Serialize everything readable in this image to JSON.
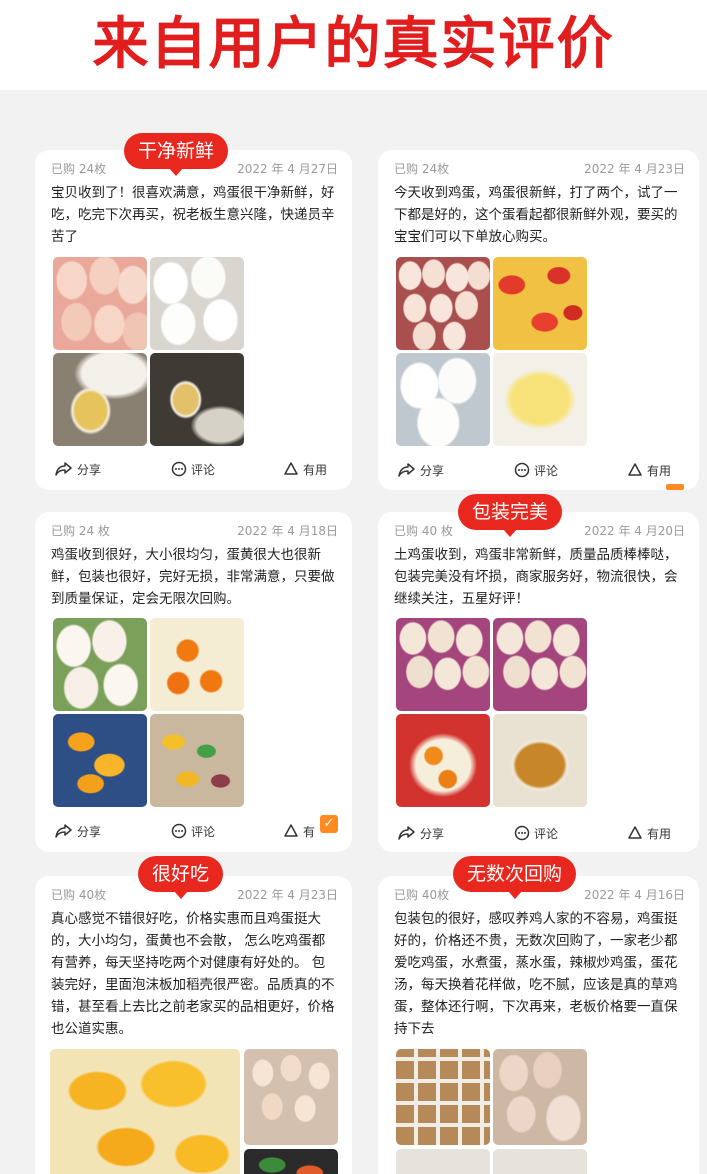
{
  "headline": "来自用户的真实评价",
  "colors": {
    "accent_red": "#e8281f",
    "headline_red": "#e11d1d",
    "check_orange": "#ff8a1f"
  },
  "actions": {
    "share": "分享",
    "comment": "评论",
    "useful": "有用"
  },
  "icons": {
    "share": "share-icon",
    "comment": "comment-icon",
    "useful": "thumb-up-icon"
  },
  "reviews": [
    {
      "tag": "干净新鲜",
      "quantity": "已购 24枚",
      "date": "2022 年 4 月27日",
      "text": "宝贝收到了！很喜欢满意，鸡蛋很干净新鲜，好吃，吃完下次再买，祝老板生意兴隆，快递员辛苦了",
      "useful_label": "有用"
    },
    {
      "tag": "",
      "quantity": "已购 24枚",
      "date": "2022 年 4 月23日",
      "text": "今天收到鸡蛋，鸡蛋很新鲜，打了两个，试了一下都是好的，这个蛋看起都很新鲜外观，要买的宝宝们可以下单放心购买。",
      "useful_label": "有用"
    },
    {
      "tag": "",
      "quantity": "已购 24 枚",
      "date": "2022 年 4 月18日",
      "text": "鸡蛋收到很好，大小很均匀，蛋黄很大也很新鲜，包装也很好，完好无损，非常满意，只要做到质量保证，定会无限次回购。",
      "useful_label": "有"
    },
    {
      "tag": "包装完美",
      "quantity": "已购 40 枚",
      "date": "2022 年 4 月20日",
      "text": "土鸡蛋收到，鸡蛋非常新鲜，质量品质棒棒哒，包装完美没有坏损，商家服务好，物流很快，会继续关注，五星好评！",
      "useful_label": "有用"
    },
    {
      "tag": "很好吃",
      "quantity": "已购 40枚",
      "date": "2022 年 4 月23日",
      "text": "真心感觉不错很好吃，价格实惠而且鸡蛋挺大的，大小均匀，蛋黄也不会散， 怎么吃鸡蛋都有营养，每天坚持吃两个对健康有好处的。 包装完好，里面泡沫板加稻壳很严密。品质真的不错，甚至看上去比之前老家买的品相更好，价格也公道实惠。",
      "useful_label": ""
    },
    {
      "tag": "无数次回购",
      "quantity": "已购 40枚",
      "date": "2022 年 4 月16日",
      "text": "包装包的很好，感叹养鸡人家的不容易，鸡蛋挺好的，价格还不贵，无数次回购了，一家老少都爱吃鸡蛋，水煮蛋，蒸水蛋，辣椒炒鸡蛋，蛋花汤，每天换着花样做，吃不腻，应该是真的草鸡蛋，整体还行啊，下次再来，老板价格要一直保持下去",
      "useful_label": ""
    }
  ]
}
